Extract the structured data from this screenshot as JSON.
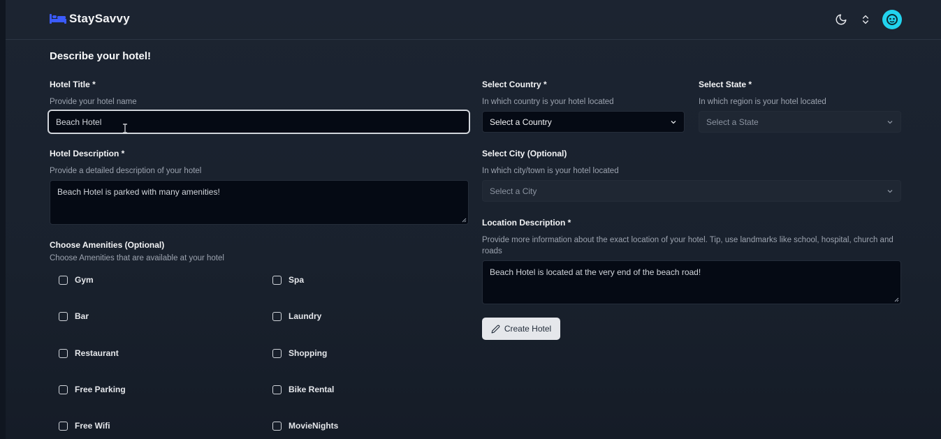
{
  "brand": {
    "name": "StaySavvy",
    "accent": "#3b5bfd"
  },
  "header": {
    "icons": [
      "moon-icon",
      "chevron-updown-icon",
      "avatar"
    ],
    "avatar_color": "#22d3ee"
  },
  "form": {
    "title": "Describe your hotel!",
    "hotel_title": {
      "label": "Hotel Title *",
      "hint": "Provide your hotel name",
      "value": "Beach Hotel"
    },
    "hotel_description": {
      "label": "Hotel Description *",
      "hint": "Provide a detailed description of your hotel",
      "value": "Beach Hotel is parked with many amenities!"
    },
    "amenities": {
      "label": "Choose Amenities (Optional)",
      "hint": "Choose Amenities that are available at your hotel",
      "items": [
        {
          "label": "Gym",
          "checked": false
        },
        {
          "label": "Spa",
          "checked": false
        },
        {
          "label": "Bar",
          "checked": false
        },
        {
          "label": "Laundry",
          "checked": false
        },
        {
          "label": "Restaurant",
          "checked": false
        },
        {
          "label": "Shopping",
          "checked": false
        },
        {
          "label": "Free Parking",
          "checked": false
        },
        {
          "label": "Bike Rental",
          "checked": false
        },
        {
          "label": "Free Wifi",
          "checked": false
        },
        {
          "label": "MovieNights",
          "checked": false
        }
      ]
    },
    "country": {
      "label": "Select Country *",
      "hint": "In which country is your hotel located",
      "value": "Select a Country"
    },
    "state": {
      "label": "Select State *",
      "hint": "In which region is your hotel located",
      "value": "Select a State"
    },
    "city": {
      "label": "Select City (Optional)",
      "hint": "In which city/town is your hotel located",
      "value": "Select a City"
    },
    "location_description": {
      "label": "Location Description *",
      "hint": "Provide more information about the exact location of your hotel. Tip, use landmarks like school, hospital, church and roads",
      "value": "Beach Hotel is located at the very end of the beach road!"
    },
    "submit_label": "Create Hotel"
  }
}
